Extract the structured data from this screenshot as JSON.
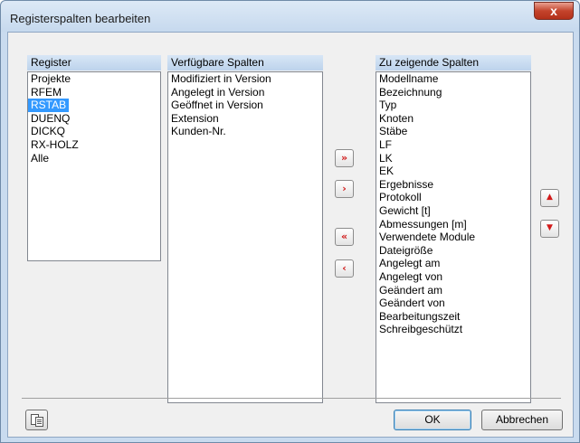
{
  "window": {
    "title": "Registerspalten bearbeiten",
    "close_label": "x"
  },
  "register": {
    "header": "Register",
    "items": [
      {
        "label": "Projekte",
        "selected": false
      },
      {
        "label": "RFEM",
        "selected": false
      },
      {
        "label": "RSTAB",
        "selected": true
      },
      {
        "label": "DUENQ",
        "selected": false
      },
      {
        "label": "DICKQ",
        "selected": false
      },
      {
        "label": "RX-HOLZ",
        "selected": false
      },
      {
        "label": "Alle",
        "selected": false
      }
    ]
  },
  "available": {
    "header": "Verfügbare Spalten",
    "items": [
      "Modifiziert in Version",
      "Angelegt in Version",
      "Geöffnet in Version",
      "Extension",
      "Kunden-Nr."
    ]
  },
  "shown": {
    "header": "Zu zeigende Spalten",
    "items": [
      "Modellname",
      "Bezeichnung",
      "Typ",
      "Knoten",
      "Stäbe",
      "LF",
      "LK",
      "EK",
      "Ergebnisse",
      "Protokoll",
      "Gewicht [t]",
      "Abmessungen [m]",
      "Verwendete Module",
      "Dateigröße",
      "Angelegt am",
      "Angelegt von",
      "Geändert am",
      "Geändert von",
      "Bearbeitungszeit",
      "Schreibgeschützt"
    ]
  },
  "transfer": {
    "add_all": "»",
    "add_one": "›",
    "remove_all": "«",
    "remove_one": "‹"
  },
  "order": {
    "up": "▲",
    "down": "▼"
  },
  "footer": {
    "ok_label": "OK",
    "cancel_label": "Abbrechen"
  },
  "colors": {
    "selection": "#3399ff",
    "arrow": "#d21a1a",
    "header": "#bdd3ec"
  }
}
